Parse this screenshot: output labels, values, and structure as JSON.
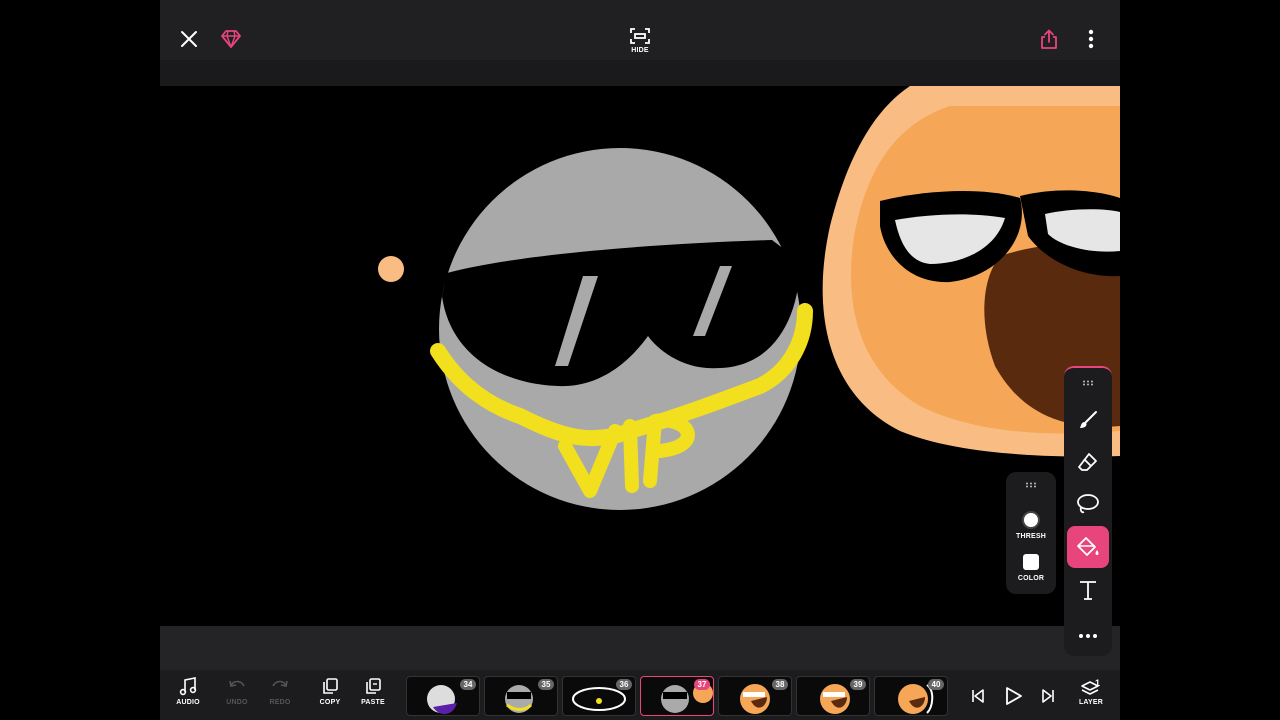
{
  "top": {
    "close_icon": "close-icon",
    "premium_icon": "gem-icon",
    "hide_label": "HIDE",
    "share_icon": "share-icon",
    "more_icon": "more-vertical-icon"
  },
  "bottom": {
    "audio_label": "AUDIO",
    "undo_label": "UNDO",
    "redo_label": "REDO",
    "copy_label": "COPY",
    "paste_label": "PASTE",
    "layer_label": "LAYER",
    "layer_count": "1",
    "frames": [
      {
        "num": "34",
        "active": false
      },
      {
        "num": "35",
        "active": false
      },
      {
        "num": "36",
        "active": false
      },
      {
        "num": "37",
        "active": true
      },
      {
        "num": "38",
        "active": false
      },
      {
        "num": "39",
        "active": false
      },
      {
        "num": "40",
        "active": false
      }
    ]
  },
  "fill_panel": {
    "threshold_label": "THRESH",
    "color_label": "COLOR"
  },
  "colors": {
    "accent": "#e8457c",
    "bar": "#1c1c1e",
    "gray_face": "#a9a9a9",
    "yellow": "#f2e01e",
    "orange_face": "#f5a757",
    "orange_outline": "#f9bd84"
  }
}
